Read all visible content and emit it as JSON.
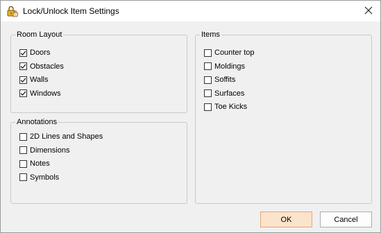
{
  "window": {
    "title": "Lock/Unlock Item Settings",
    "close_glyph": "✕"
  },
  "room_layout": {
    "title": "Room Layout",
    "items": [
      {
        "label": "Doors",
        "checked": true
      },
      {
        "label": "Obstacles",
        "checked": true
      },
      {
        "label": "Walls",
        "checked": true
      },
      {
        "label": "Windows",
        "checked": true
      }
    ]
  },
  "annotations": {
    "title": "Annotations",
    "items": [
      {
        "label": "2D Lines and Shapes",
        "checked": false
      },
      {
        "label": "Dimensions",
        "checked": false
      },
      {
        "label": "Notes",
        "checked": false
      },
      {
        "label": "Symbols",
        "checked": false
      }
    ]
  },
  "items": {
    "title": "Items",
    "items": [
      {
        "label": "Counter top",
        "checked": false
      },
      {
        "label": "Moldings",
        "checked": false
      },
      {
        "label": "Soffits",
        "checked": false
      },
      {
        "label": "Surfaces",
        "checked": false
      },
      {
        "label": "Toe Kicks",
        "checked": false
      }
    ]
  },
  "buttons": {
    "ok": "OK",
    "cancel": "Cancel"
  },
  "colors": {
    "dialog_bg": "#f0f0f0",
    "ok_bg": "#fbe3cc",
    "ok_border": "#e2a877"
  },
  "icons": {
    "app": "lock-hand-icon",
    "close": "close-icon",
    "check": "checkmark-icon"
  }
}
